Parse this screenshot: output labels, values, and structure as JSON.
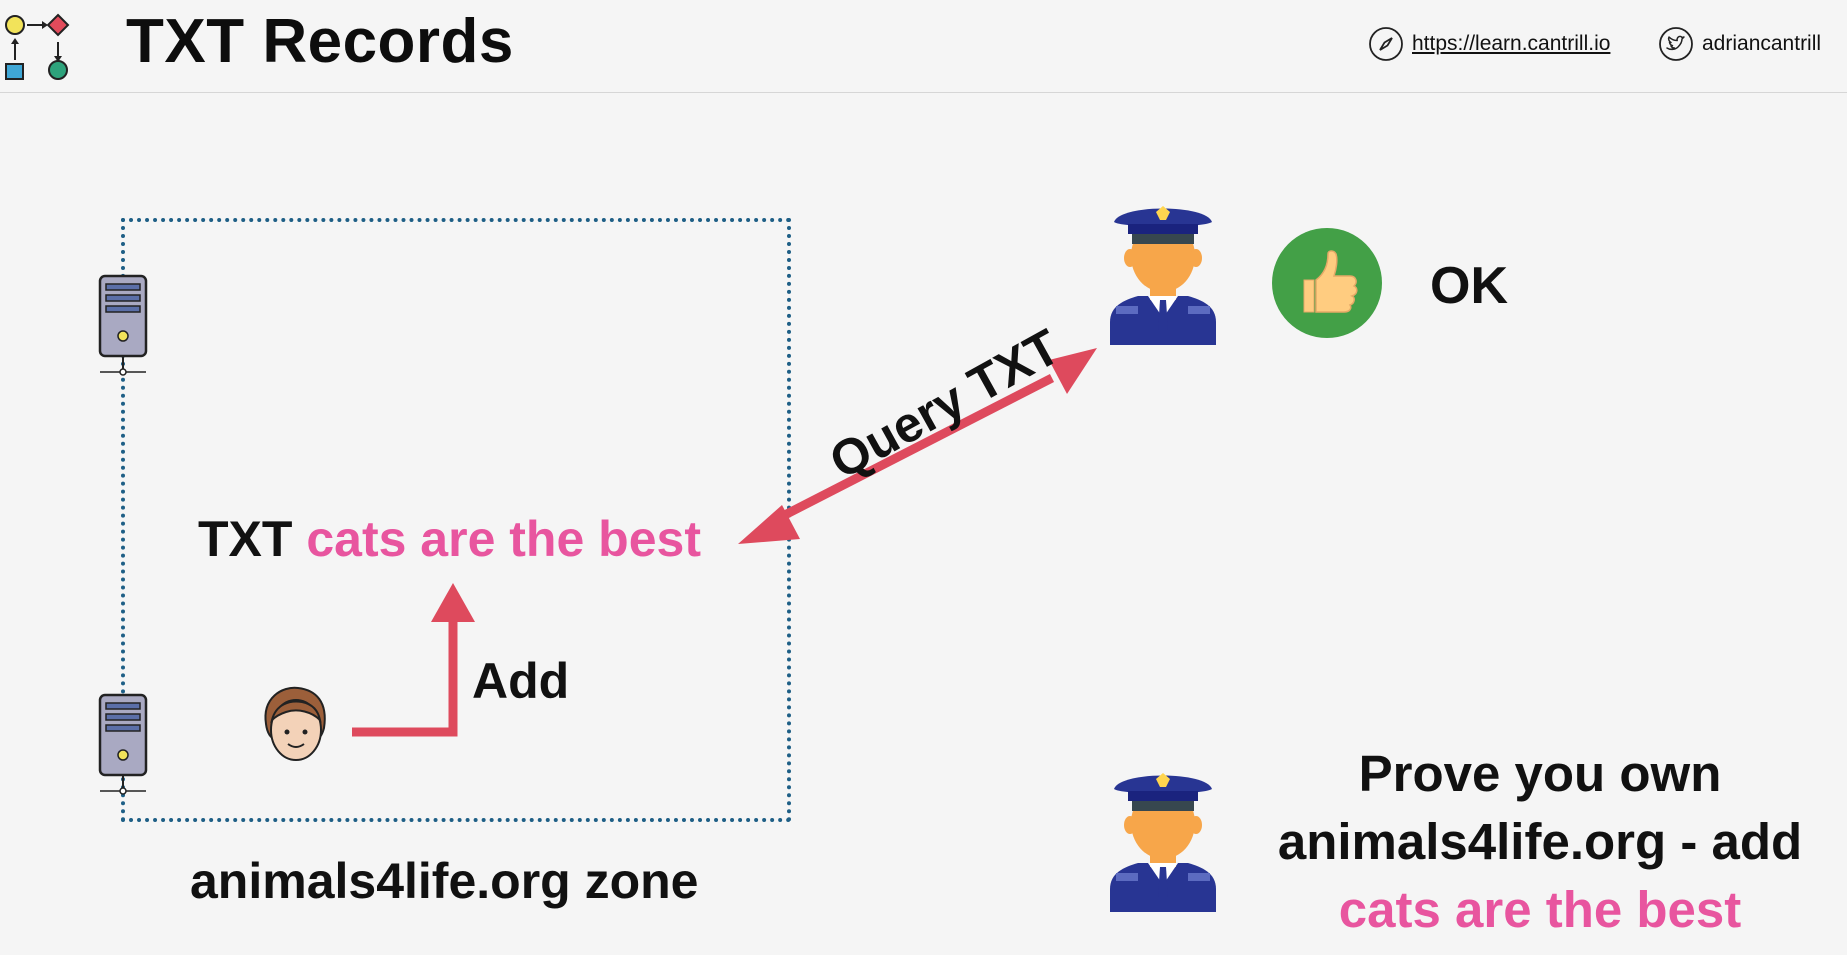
{
  "header": {
    "title": "TXT Records",
    "website": "https://learn.cantrill.io",
    "twitter": "adriancantrill"
  },
  "diagram": {
    "zone_label": "animals4life.org zone",
    "record_type": "TXT",
    "record_value": "cats are the best",
    "add_label": "Add",
    "query_label": "Query TXT",
    "ok_label": "OK",
    "prove_line1": "Prove you own",
    "prove_line2": "animals4life.org - add",
    "prove_line3": "cats are the best"
  },
  "colors": {
    "accent_pink": "#e8559f",
    "arrow_red": "#de4a5d",
    "zone_border": "#1e5f86",
    "ok_green": "#43a047"
  },
  "icons": {
    "logo": "workflow-logo-icon",
    "website": "compass-icon",
    "twitter": "twitter-bird-icon",
    "server": "server-icon",
    "user": "user-avatar-icon",
    "officer": "police-officer-icon",
    "thumbs_up": "thumbs-up-icon"
  }
}
